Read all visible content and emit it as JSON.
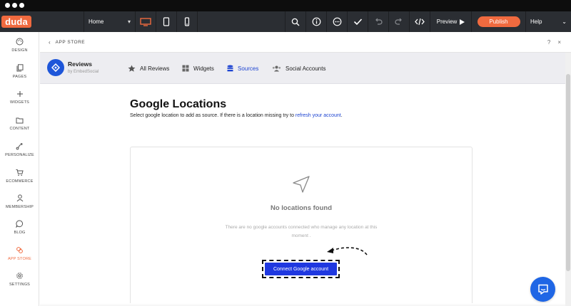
{
  "topbar": {
    "logo": "duda",
    "page_select": "Home",
    "preview_label": "Preview",
    "publish_label": "Publish",
    "help_label": "Help"
  },
  "sidebar": {
    "items": [
      {
        "label": "DESIGN",
        "icon": "palette-icon"
      },
      {
        "label": "PAGES",
        "icon": "pages-icon"
      },
      {
        "label": "WIDGETS",
        "icon": "plus-icon"
      },
      {
        "label": "CONTENT",
        "icon": "folder-icon"
      },
      {
        "label": "PERSONALIZE",
        "icon": "personalize-icon"
      },
      {
        "label": "ECOMMERCE",
        "icon": "cart-icon"
      },
      {
        "label": "MEMBERSHIP",
        "icon": "user-icon"
      },
      {
        "label": "BLOG",
        "icon": "chat-bubble-icon"
      },
      {
        "label": "APP STORE",
        "icon": "app-store-icon"
      },
      {
        "label": "SETTINGS",
        "icon": "gear-icon"
      }
    ],
    "active_color": "#f06a3f"
  },
  "panel": {
    "title": "APP STORE",
    "help": "?",
    "close": "×"
  },
  "app": {
    "name": "Reviews",
    "by": "by EmbedSocial",
    "tabs": [
      {
        "label": "All Reviews",
        "icon": "star-icon"
      },
      {
        "label": "Widgets",
        "icon": "grid-icon"
      },
      {
        "label": "Sources",
        "icon": "database-icon"
      },
      {
        "label": "Social Accounts",
        "icon": "users-icon"
      }
    ],
    "active_tab": "Sources"
  },
  "main": {
    "heading": "Google Locations",
    "sub_text": "Select google location to add as source. If there is a location missing try to ",
    "sub_link": "refresh your account",
    "sub_end": ".",
    "empty_title": "No locations found",
    "empty_desc": "There are no google accounts connected who manage any location at this moment .",
    "connect_label": "Connect Google account"
  },
  "colors": {
    "brand": "#f06a3f",
    "accent": "#1e45d2",
    "button": "#1f38e0"
  }
}
